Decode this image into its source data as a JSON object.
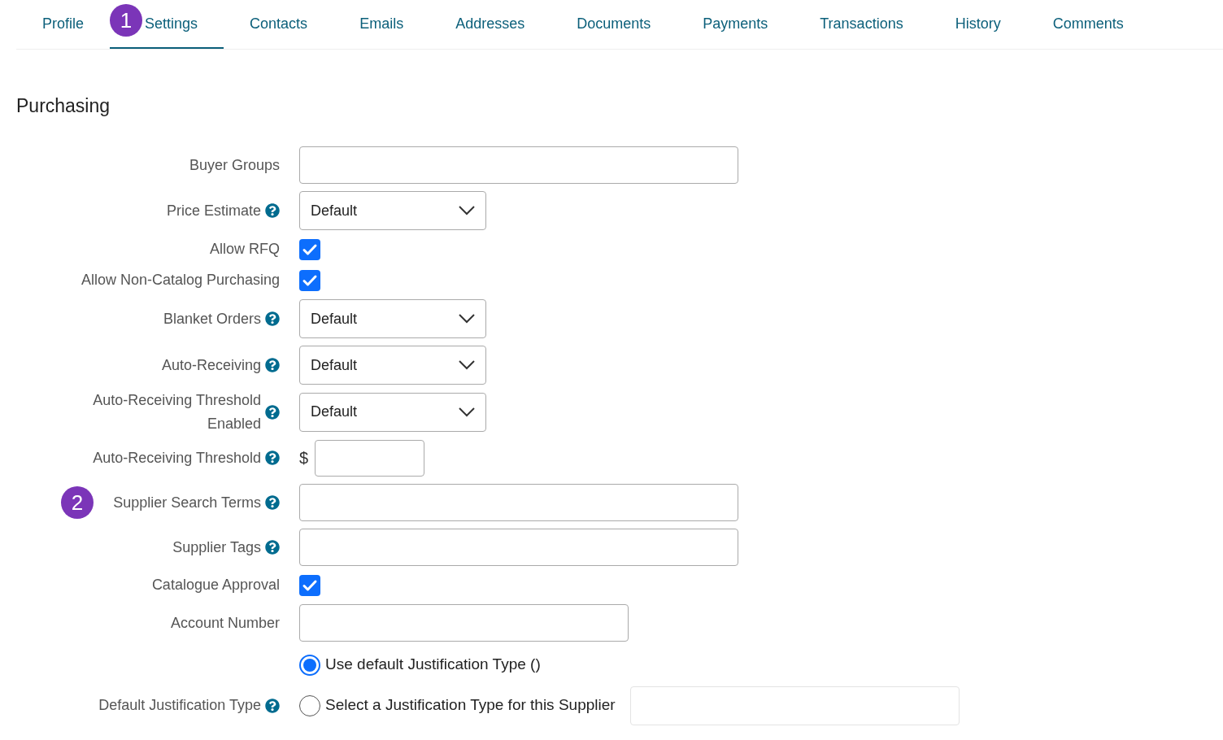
{
  "tabs": [
    {
      "label": "Profile",
      "selected": false
    },
    {
      "label": "Settings",
      "selected": true,
      "badge": "1"
    },
    {
      "label": "Contacts",
      "selected": false
    },
    {
      "label": "Emails",
      "selected": false
    },
    {
      "label": "Addresses",
      "selected": false
    },
    {
      "label": "Documents",
      "selected": false
    },
    {
      "label": "Payments",
      "selected": false
    },
    {
      "label": "Transactions",
      "selected": false
    },
    {
      "label": "History",
      "selected": false
    },
    {
      "label": "Comments",
      "selected": false
    }
  ],
  "section": {
    "title": "Purchasing"
  },
  "rows": [
    {
      "kind": "wide-text",
      "label": "Buyer Groups",
      "help": false
    },
    {
      "kind": "select",
      "label": "Price Estimate",
      "help": true,
      "value": "Default"
    },
    {
      "kind": "checkbox",
      "label": "Allow RFQ",
      "help": false,
      "checked": true
    },
    {
      "kind": "checkbox",
      "label": "Allow Non-Catalog Purchasing",
      "help": false,
      "checked": true
    },
    {
      "kind": "select",
      "label": "Blanket Orders",
      "help": true,
      "value": "Default"
    },
    {
      "kind": "select",
      "label": "Auto-Receiving",
      "help": true,
      "value": "Default"
    },
    {
      "kind": "select",
      "label": "Auto-Receiving Threshold Enabled",
      "help": true,
      "value": "Default"
    },
    {
      "kind": "money",
      "label": "Auto-Receiving Threshold",
      "help": true,
      "currency": "$"
    },
    {
      "kind": "wide-text",
      "label": "Supplier Search Terms",
      "help": true,
      "badge": "2"
    },
    {
      "kind": "wide-text",
      "label": "Supplier Tags",
      "help": true
    },
    {
      "kind": "checkbox",
      "label": "Catalogue Approval",
      "help": false,
      "checked": true
    },
    {
      "kind": "text",
      "label": "Account Number",
      "help": false
    },
    {
      "kind": "radio",
      "label": "Default Justification Type",
      "help": true,
      "options": [
        {
          "label": "Use default Justification Type ()",
          "selected": true,
          "field": false
        },
        {
          "label": "Select a Justification Type for this Supplier",
          "selected": false,
          "field": true
        }
      ]
    }
  ]
}
